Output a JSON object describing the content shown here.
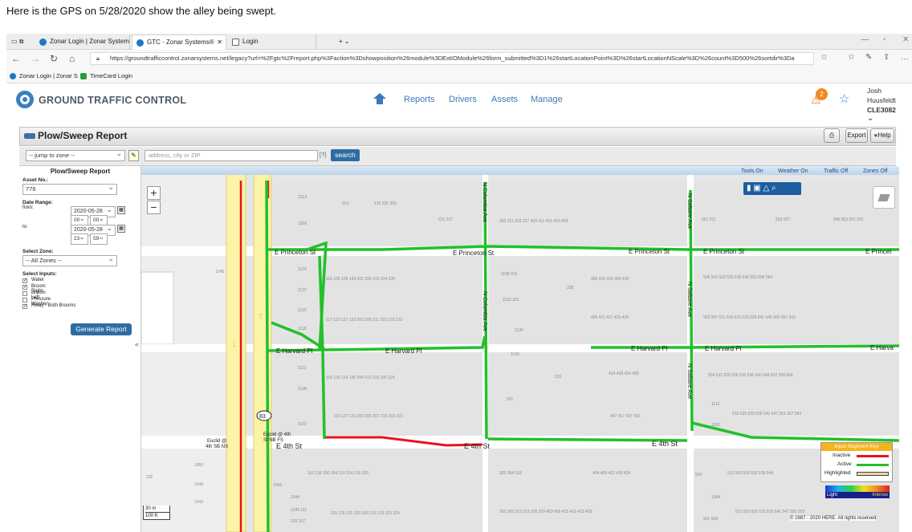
{
  "caption": "Here is the GPS on 5/28/2020 show the alley being swept.",
  "browser": {
    "tabs": [
      "Zonar Login | Zonar System",
      "GTC - Zonar Systems®",
      "Login"
    ],
    "url": "https://groundtrafficcontrol.zonarsystems.net/legacy?url=%2Fgtc%2Freport.php%3Faction%3Dshowposition%26module%3DExtIOModule%26form_submitted%3D1%26startLocationPoint%3D%26startLocationNScale%3D%26count%3D500%26sortdir%3Da",
    "favorites": [
      "Zonar Login | Zonar S",
      "TimeCard Login"
    ]
  },
  "app": {
    "logo_text": "GROUND TRAFFIC CONTROL",
    "nav": [
      "Reports",
      "Drivers",
      "Assets",
      "Manage"
    ],
    "alert_count": "2",
    "user_name": "Josh Huusfeldt",
    "user_code": "CLE3082"
  },
  "report": {
    "title": "Plow/Sweep Report",
    "print_label": "",
    "export_label": "Export",
    "help_label": "Help",
    "jump_zone": "-- jump to zone --",
    "address_placeholder": "address, city or ZIP",
    "search_label": "search",
    "qmark": "[?]"
  },
  "sidebar": {
    "title": "Plow/Sweep Report",
    "asset_label": "Asset No.:",
    "asset_value": "776",
    "date_label": "Date Range:",
    "from_label": "from:",
    "from_date": "2020-05-28",
    "from_h": "00",
    "from_m": "00",
    "to_label": "to:",
    "to_date": "2020-05-28",
    "to_h": "23",
    "to_m": "59",
    "zone_label": "Select Zone:",
    "zone_value": "-- All Zones --",
    "inputs_label": "Select Inputs:",
    "inputs": [
      {
        "label": "Water",
        "checked": true
      },
      {
        "label": "Broom Right",
        "checked": true
      },
      {
        "label": "Broom Left",
        "checked": false
      },
      {
        "label": "Pressure Washer",
        "checked": false
      },
      {
        "label": "Relay - Both Brooms",
        "checked": true
      }
    ],
    "generate_label": "Generate Report",
    "collapse": "«"
  },
  "map": {
    "toolbar": [
      "Tools On",
      "Weather On",
      "Traffic Off",
      "Zones Off"
    ],
    "streets": {
      "princeton": [
        "E Princeton St",
        "E Princeton St",
        "E Princeton St",
        "E Princeton St",
        "E Princet"
      ],
      "harvard": [
        "E Harvard Pl",
        "E Harvard Pl",
        "E Harvard Pl",
        "E Harvard Pl",
        "E Harva"
      ],
      "fourth": [
        "E 4th St",
        "E 4th St",
        "E 4th St"
      ],
      "columbia": "N Columbia Ave",
      "saltaire": "N Saltaire Ave",
      "euclid_left": "Euclid @ 4th SB NS",
      "euclid_right": "Euclid @ 4th St NB FS",
      "route": "83"
    },
    "scale": [
      "30 m",
      "100 ft"
    ],
    "legend": {
      "title": "Input Segment Key",
      "rows": [
        "Inactive",
        "Active",
        "Highlighted"
      ],
      "gradient": [
        "Light",
        "Intense"
      ]
    },
    "copyright": "© 1987 - 2020 HERE. All rights reserved",
    "colors": {
      "active": "#22c02a",
      "inactive": "#e8141a",
      "highlight": "#e8d7a0",
      "road": "#fbf3a6"
    }
  }
}
